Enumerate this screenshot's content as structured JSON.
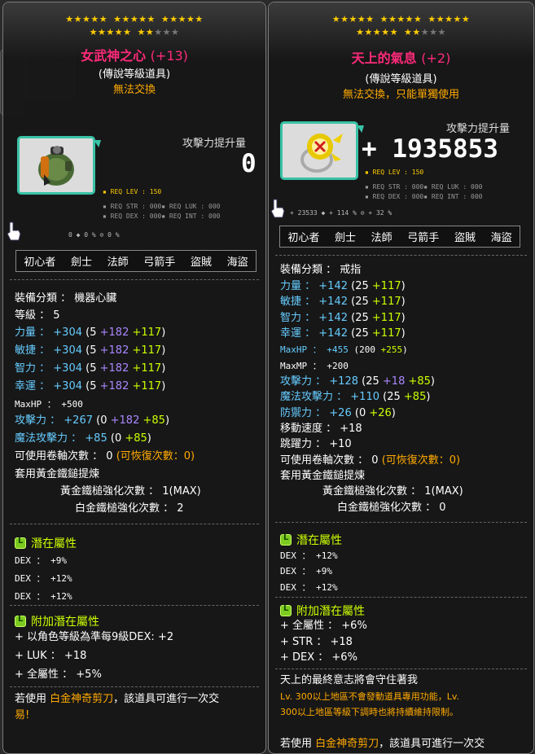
{
  "left": {
    "stars_on": 17,
    "stars_total": 20,
    "name": "女武神之心",
    "plus": "(+13)",
    "grade": "(傳說等級道具)",
    "trade": "無法交換",
    "atk_label": "攻擊力提升量",
    "atk_value": "0",
    "req": {
      "lev": "▪ REQ LEV :   150",
      "str_luk": "▪ REQ STR :  000▪  REQ LUK :  000",
      "dex_int": "▪ REQ DEX :  000▪  REQ INT :  000"
    },
    "small_stats": "0  ◆    0 %  ⊘    0 %",
    "classes": [
      "初心者",
      "劍士",
      "法師",
      "弓箭手",
      "盜賊",
      "海盜"
    ],
    "category": "裝備分類 ： 機器心臟",
    "level": "等級 ： 5",
    "stats": [
      {
        "label": "力量",
        "total": "+304",
        "base": "5",
        "a": "+182",
        "b": "+117"
      },
      {
        "label": "敏捷",
        "total": "+304",
        "base": "5",
        "a": "+182",
        "b": "+117"
      },
      {
        "label": "智力",
        "total": "+304",
        "base": "5",
        "a": "+182",
        "b": "+117"
      },
      {
        "label": "幸運",
        "total": "+304",
        "base": "5",
        "a": "+182",
        "b": "+117"
      }
    ],
    "maxhp": "MaxHP ： +500",
    "atk": {
      "label": "攻擊力",
      "total": "+267",
      "base": "0",
      "a": "+182",
      "b": "+85"
    },
    "matk": {
      "label": "魔法攻擊力",
      "total": "+85",
      "base": "0",
      "b": "+85"
    },
    "scroll": "可使用卷軸次數 ： 0",
    "scroll_recover": "(可恢復次數：0)",
    "hammer": "套用黃金鐵鎚提煉",
    "gold_hammer": "黃金鐵槌強化次數 ： 1(MAX)",
    "plat_hammer": "白金鐵槌強化次數 ： 2",
    "pot_title": "潛在屬性",
    "pot": [
      "DEX ： +9%",
      "DEX ： +12%",
      "DEX ： +12%"
    ],
    "add_title": "附加潛在屬性",
    "add": [
      "+ 以角色等級為準每9級DEX: +2",
      "+ LUK ： +18",
      "+ 全屬性 ： +5%"
    ],
    "scissor_prefix": "若使用 ",
    "scissor_name": "白金神奇剪刀",
    "scissor_suffix": "，該道具可進行一次交",
    "scissor_tail": "易!"
  },
  "right": {
    "stars_on": 17,
    "stars_total": 20,
    "name": "天上的氣息",
    "plus": "(+2)",
    "grade": "(傳說等級道具)",
    "trade": "無法交換，只能單獨使用",
    "atk_label": "攻擊力提升量",
    "atk_value": "+ 1935853",
    "req": {
      "lev": "▪ REQ LEV :   150",
      "str_luk": "▪ REQ STR :  000▪  REQ LUK :  000",
      "dex_int": "▪ REQ DEX :  000▪  REQ INT :  000"
    },
    "small_stats": "+ 23533  ◆   + 114 %  ⊘   + 32 %",
    "classes": [
      "初心者",
      "劍士",
      "法師",
      "弓箭手",
      "盜賊",
      "海盜"
    ],
    "category": "裝備分類 ： 戒指",
    "stats": [
      {
        "label": "力量",
        "total": "+142",
        "base": "25",
        "b": "+117"
      },
      {
        "label": "敏捷",
        "total": "+142",
        "base": "25",
        "b": "+117"
      },
      {
        "label": "智力",
        "total": "+142",
        "base": "25",
        "b": "+117"
      },
      {
        "label": "幸運",
        "total": "+142",
        "base": "25",
        "b": "+117"
      }
    ],
    "maxhp": {
      "label": "MaxHP",
      "total": "+455",
      "base": "200",
      "b": "+255"
    },
    "maxmp": "MaxMP ： +200",
    "atk": {
      "label": "攻擊力",
      "total": "+128",
      "base": "25",
      "a": "+18",
      "b": "+85"
    },
    "matk": {
      "label": "魔法攻擊力",
      "total": "+110",
      "base": "25",
      "b": "+85"
    },
    "def": {
      "label": "防禦力",
      "total": "+26",
      "base": "0",
      "b": "+26"
    },
    "speed": "移動速度 ： +18",
    "jump": "跳躍力 ： +10",
    "scroll": "可使用卷軸次數 ： 0",
    "scroll_recover": "(可恢復次數：0)",
    "hammer": "套用黃金鐵鎚提煉",
    "gold_hammer": "黃金鐵槌強化次數 ： 1(MAX)",
    "plat_hammer": "白金鐵槌強化次數 ： 0",
    "pot_title": "潛在屬性",
    "pot": [
      "DEX ： +12%",
      "DEX ： +9%",
      "DEX ： +12%"
    ],
    "add_title": "附加潛在屬性",
    "add": [
      "+ 全屬性 ： +6%",
      "+ STR ： +18",
      "+ DEX ： +6%"
    ],
    "desc": "天上的最終意志將會守住著我",
    "desc_orange_1": "Lv. 300以上地區不會發動道具專用功能，Lv.",
    "desc_orange_2": "300以上地區等級下調時也將持續維持限制。",
    "scissor_prefix": "若使用 ",
    "scissor_name": "白金神奇剪刀",
    "scissor_suffix": "，該道具可進行一次交"
  },
  "colors": {
    "title": "#ff2a7a",
    "trade": "#ffaa00",
    "stat_label": "#66ccff",
    "upgrade": "#aa88ff",
    "star_force": "#ccff00",
    "frame": "#39c2a6"
  }
}
